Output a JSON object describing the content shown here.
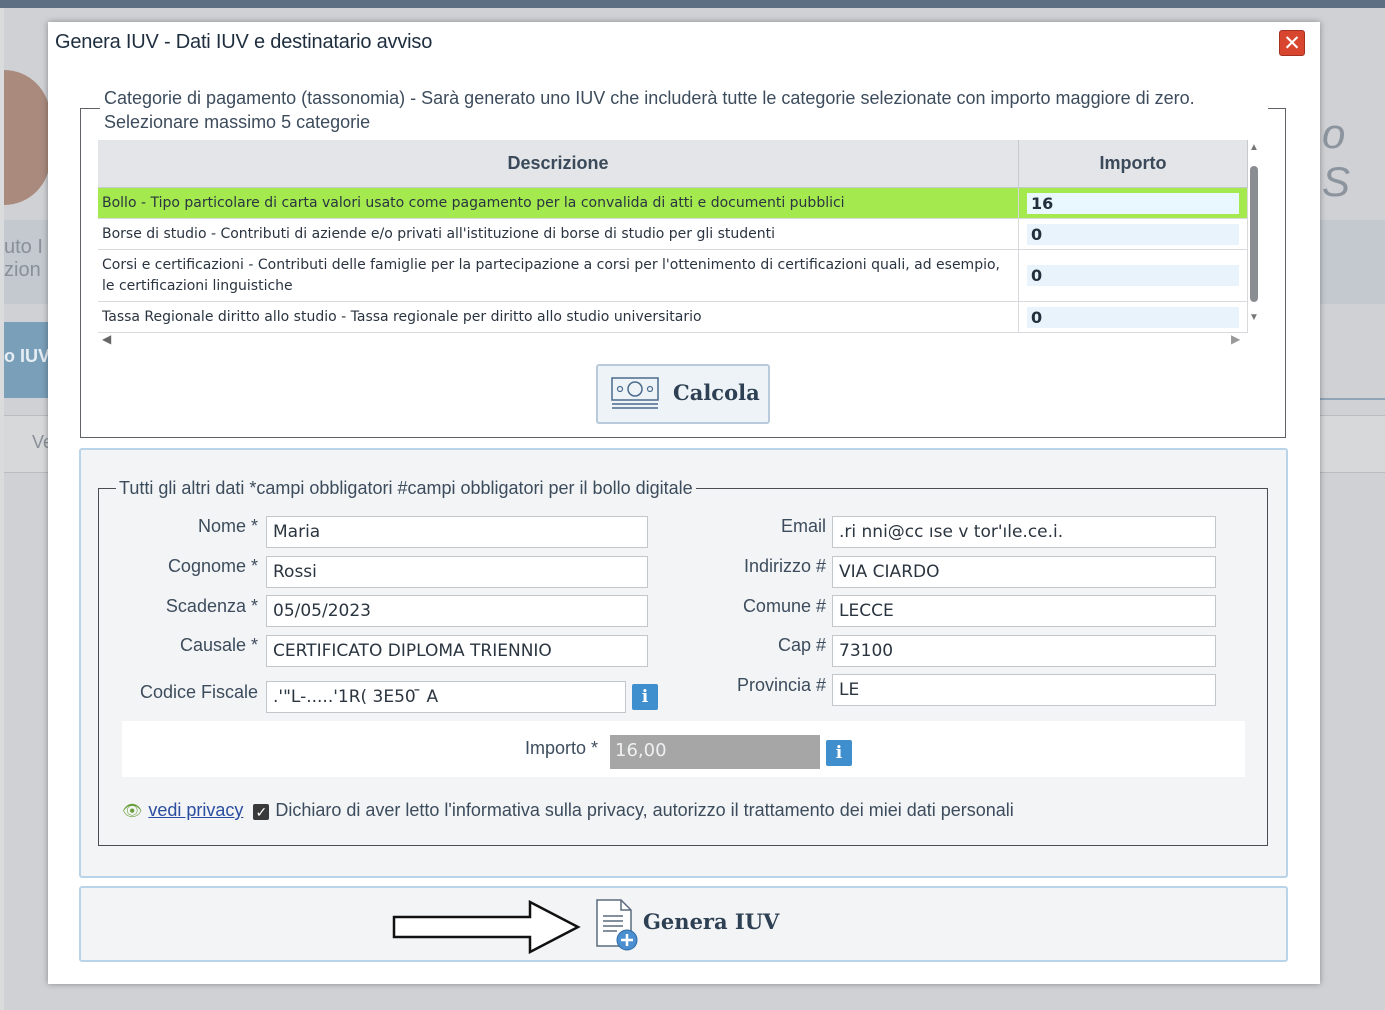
{
  "background": {
    "left_band_lines": [
      "uto I",
      "zion"
    ],
    "left_tab": "o IUV",
    "left_row": "Ve",
    "right_text": "o S"
  },
  "dialog": {
    "title": "Genera IUV - Dati IUV e destinatario avviso",
    "close_icon": "close-icon",
    "close_symbol": "✕"
  },
  "categories": {
    "legend": "Categorie di pagamento (tassonomia) - Sarà generato uno IUV che includerà tutte le categorie selezionate con importo maggiore di zero. Selezionare massimo 5 categorie",
    "columns": [
      "Descrizione",
      "Importo"
    ],
    "rows": [
      {
        "descrizione": "Bollo - Tipo particolare di carta valori usato come pagamento per la convalida di atti e documenti pubblici",
        "importo": "16",
        "selected": true
      },
      {
        "descrizione": "Borse di studio - Contributi di aziende e/o privati all'istituzione di borse di studio per gli studenti",
        "importo": "0",
        "selected": false
      },
      {
        "descrizione": "Corsi e certificazioni - Contributi delle famiglie per la partecipazione a corsi per l'ottenimento di certificazioni quali, ad esempio, le certificazioni linguistiche",
        "importo": "0",
        "selected": false
      },
      {
        "descrizione": "Tassa Regionale diritto allo studio - Tassa regionale per diritto allo studio universitario",
        "importo": "0",
        "selected": false
      }
    ],
    "selected_row_color": "#a4ea4e",
    "calcola_label": "Calcola",
    "calcola_icon": "money-icon"
  },
  "form": {
    "legend": "Tutti gli altri dati  *campi obbligatori  #campi obbligatori per il bollo digitale",
    "nome": {
      "label": "Nome *",
      "value": "Maria"
    },
    "cognome": {
      "label": "Cognome *",
      "value": "Rossi"
    },
    "scadenza": {
      "label": "Scadenza *",
      "value": "05/05/2023"
    },
    "causale": {
      "label": "Causale *",
      "value": "CERTIFICATO DIPLOMA TRIENNIO"
    },
    "codice_fiscale": {
      "label": "Codice Fiscale",
      "value": ".'\"L-.....'1R( 3E50 ̄ A"
    },
    "email": {
      "label": "Email",
      "value": ".ri  nni@cc  ıse  v  tor'ıle.ce.i."
    },
    "indirizzo": {
      "label": "Indirizzo #",
      "value": "VIA CIARDO"
    },
    "comune": {
      "label": "Comune #",
      "value": "LECCE"
    },
    "cap": {
      "label": "Cap #",
      "value": "73100"
    },
    "provincia": {
      "label": "Provincia #",
      "value": "LE"
    },
    "importo": {
      "label": "Importo *",
      "value": "16,00"
    },
    "info_symbol": "i",
    "privacy_link": "vedi privacy",
    "privacy_text": "Dichiaro di aver letto l'informativa sulla privacy, autorizzo il trattamento dei miei dati personali",
    "privacy_checked": true
  },
  "actions": {
    "genera_label": "Genera IUV",
    "genera_icon": "document-add-icon",
    "arrow_icon": "right-arrow-icon"
  }
}
